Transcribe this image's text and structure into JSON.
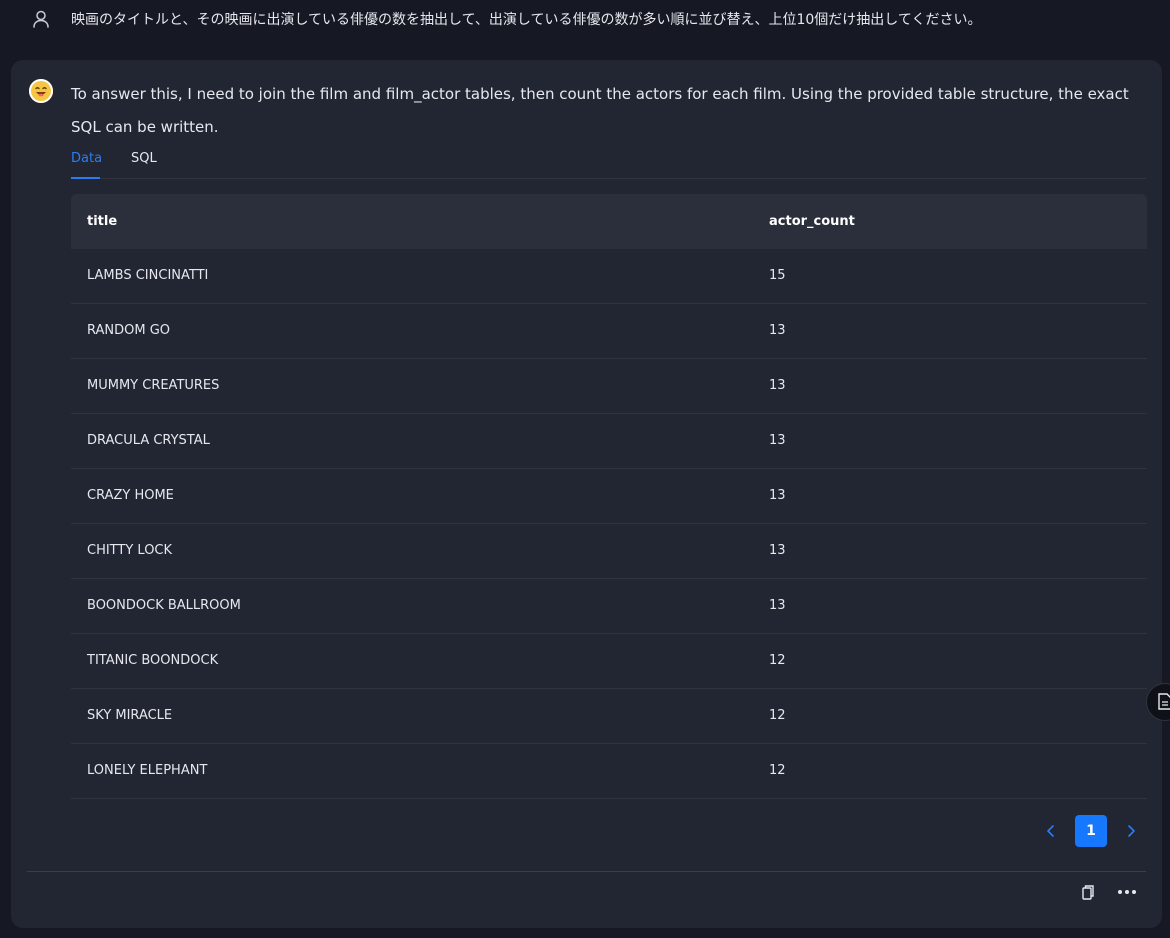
{
  "user_message": {
    "icon": "user-icon",
    "text": "映画のタイトルと、その映画に出演している俳優の数を抽出して、出演している俳優の数が多い順に並び替え、上位10個だけ抽出してください。"
  },
  "assistant_message": {
    "avatar": "smiley-avatar",
    "text": "To answer this, I need to join the film and film_actor tables, then count the actors for each film. Using the provided table structure, the exact SQL can be written."
  },
  "tabs": [
    {
      "label": "Data",
      "active": true
    },
    {
      "label": "SQL",
      "active": false
    }
  ],
  "table": {
    "columns": [
      "title",
      "actor_count"
    ],
    "rows": [
      [
        "LAMBS CINCINATTI",
        "15"
      ],
      [
        "RANDOM GO",
        "13"
      ],
      [
        "MUMMY CREATURES",
        "13"
      ],
      [
        "DRACULA CRYSTAL",
        "13"
      ],
      [
        "CRAZY HOME",
        "13"
      ],
      [
        "CHITTY LOCK",
        "13"
      ],
      [
        "BOONDOCK BALLROOM",
        "13"
      ],
      [
        "TITANIC BOONDOCK",
        "12"
      ],
      [
        "SKY MIRACLE",
        "12"
      ],
      [
        "LONELY ELEPHANT",
        "12"
      ]
    ]
  },
  "pagination": {
    "prev_icon": "chevron-left-icon",
    "current_page": "1",
    "next_icon": "chevron-right-icon"
  },
  "actions": {
    "copy_icon": "copy-icon",
    "more_icon": "more-icon"
  },
  "side_button": {
    "icon": "document-icon"
  },
  "colors": {
    "background": "#161824",
    "card": "#222633",
    "accent": "#1677ff",
    "tab_active": "#2b7cf2",
    "table_header": "#2b2f3b",
    "divider": "#30343f"
  }
}
